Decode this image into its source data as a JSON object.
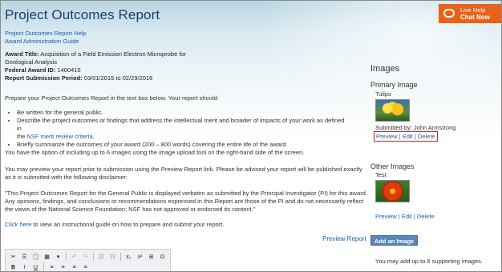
{
  "page": {
    "title": "Project Outcomes Report",
    "help_links": [
      "Project Outcomes Report Help",
      "Award Administration Guide"
    ]
  },
  "award": {
    "title_label": "Award Title:",
    "title_line1": "Acquisition of a Field Emission Electron Microprobe for",
    "title_line2": "Geological Analysis",
    "id_label": "Federal Award ID:",
    "id_value": "1400416",
    "period_label": "Report Submission Period:",
    "period_value": "03/01/2015 to 02/29/2016"
  },
  "instructions": {
    "intro": "Prepare your Project Outcomes Report in the text box below.  Your report should:",
    "bullet1": "Be written for the general public.",
    "bullet2_line1": "Describe the project outcomes or findings that address the intellectual merit and broader of impacts of your work as defined in",
    "bullet2_line2_prefix": "the ",
    "bullet2_link": "NSF merit review criteria",
    "bullet2_line2_suffix": ".",
    "bullet3": "Briefly summarize the outcomes of your award (200 – 800 words) covering the entire life of the award.",
    "images_option": "You have the option of including up to 6 images using the image upload tool on the right-hand side of the screen.",
    "preview_line1": "You may preview your report prior to submission using the Preview Report link.  Please be advised your report will be published exactly",
    "preview_line2": "as it is submitted with the following disclaimer:",
    "disclaimer_line1": "\"This Project Outcomes Report for the General Public is displayed verbatim as submitted by the Principal Investigator (PI) for this award.",
    "disclaimer_line2": "Any opinions, findings, and conclusions or recommendations expressed in this Report are those of the PI and do not necessarily reflect",
    "disclaimer_line3": "the views of the National Science Foundation; NSF has not approved or endorsed its content.\"",
    "click_here": "Click here",
    "guide_suffix": "  to view an instructional guide on how to prepare and submit your report.",
    "preview_report": "Preview Report"
  },
  "live_help": {
    "line1": "Live Help",
    "line2": "Chat Now",
    "icon": "chat-bubble-icon"
  },
  "images": {
    "heading": "Images",
    "primary_heading": "Primary Image",
    "primary_caption": "Tulips",
    "submitted_by": "Submitted by: John Armstrong",
    "other_heading": "Other Images",
    "other_caption": "Test",
    "action_preview": "Preview",
    "action_edit": "Edit",
    "action_delete": "Delete",
    "action_sep": "|",
    "add_button": "Add an Image",
    "may_add": "You may add up to 6 supporting images."
  },
  "toolbar": {
    "row1": [
      "✂",
      "⎘",
      "📋",
      "▦",
      "▾",
      "↶",
      "↷",
      "⛓",
      "⛓",
      "x₂",
      "x²",
      "⊞",
      "Ω"
    ],
    "row2": [
      "B",
      "I",
      "U",
      "≡",
      "≡",
      "≡",
      "≡"
    ]
  }
}
